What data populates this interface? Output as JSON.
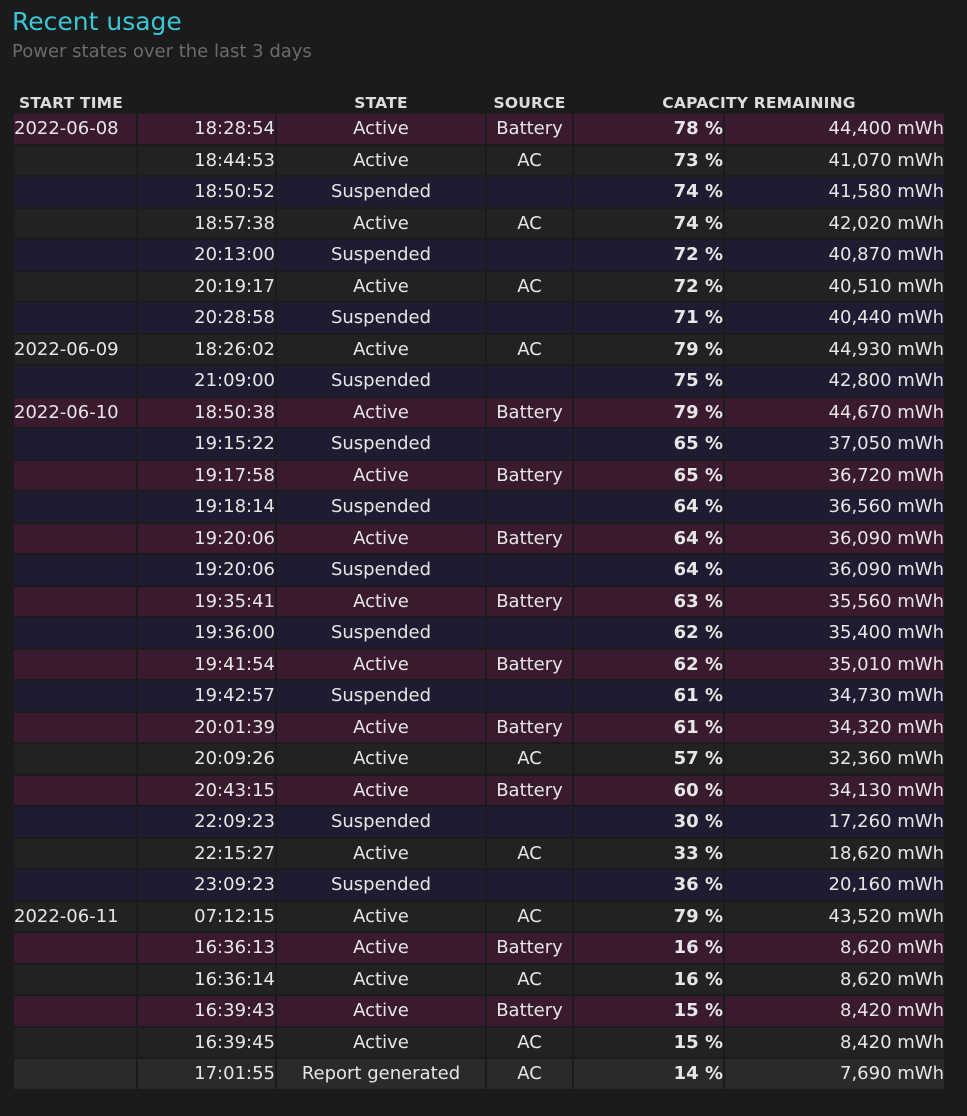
{
  "header": {
    "title": "Recent usage",
    "subtitle": "Power states over the last 3 days"
  },
  "columns": {
    "start_time": "START TIME",
    "state": "STATE",
    "source": "SOURCE",
    "capacity": "CAPACITY REMAINING"
  },
  "rows": [
    {
      "date": "2022-06-08",
      "time": "18:28:54",
      "state": "Active",
      "source": "Battery",
      "percent": "78 %",
      "capacity": "44,400 mWh"
    },
    {
      "date": "",
      "time": "18:44:53",
      "state": "Active",
      "source": "AC",
      "percent": "73 %",
      "capacity": "41,070 mWh"
    },
    {
      "date": "",
      "time": "18:50:52",
      "state": "Suspended",
      "source": "",
      "percent": "74 %",
      "capacity": "41,580 mWh"
    },
    {
      "date": "",
      "time": "18:57:38",
      "state": "Active",
      "source": "AC",
      "percent": "74 %",
      "capacity": "42,020 mWh"
    },
    {
      "date": "",
      "time": "20:13:00",
      "state": "Suspended",
      "source": "",
      "percent": "72 %",
      "capacity": "40,870 mWh"
    },
    {
      "date": "",
      "time": "20:19:17",
      "state": "Active",
      "source": "AC",
      "percent": "72 %",
      "capacity": "40,510 mWh"
    },
    {
      "date": "",
      "time": "20:28:58",
      "state": "Suspended",
      "source": "",
      "percent": "71 %",
      "capacity": "40,440 mWh"
    },
    {
      "date": "2022-06-09",
      "time": "18:26:02",
      "state": "Active",
      "source": "AC",
      "percent": "79 %",
      "capacity": "44,930 mWh"
    },
    {
      "date": "",
      "time": "21:09:00",
      "state": "Suspended",
      "source": "",
      "percent": "75 %",
      "capacity": "42,800 mWh"
    },
    {
      "date": "2022-06-10",
      "time": "18:50:38",
      "state": "Active",
      "source": "Battery",
      "percent": "79 %",
      "capacity": "44,670 mWh"
    },
    {
      "date": "",
      "time": "19:15:22",
      "state": "Suspended",
      "source": "",
      "percent": "65 %",
      "capacity": "37,050 mWh"
    },
    {
      "date": "",
      "time": "19:17:58",
      "state": "Active",
      "source": "Battery",
      "percent": "65 %",
      "capacity": "36,720 mWh"
    },
    {
      "date": "",
      "time": "19:18:14",
      "state": "Suspended",
      "source": "",
      "percent": "64 %",
      "capacity": "36,560 mWh"
    },
    {
      "date": "",
      "time": "19:20:06",
      "state": "Active",
      "source": "Battery",
      "percent": "64 %",
      "capacity": "36,090 mWh"
    },
    {
      "date": "",
      "time": "19:20:06",
      "state": "Suspended",
      "source": "",
      "percent": "64 %",
      "capacity": "36,090 mWh"
    },
    {
      "date": "",
      "time": "19:35:41",
      "state": "Active",
      "source": "Battery",
      "percent": "63 %",
      "capacity": "35,560 mWh"
    },
    {
      "date": "",
      "time": "19:36:00",
      "state": "Suspended",
      "source": "",
      "percent": "62 %",
      "capacity": "35,400 mWh"
    },
    {
      "date": "",
      "time": "19:41:54",
      "state": "Active",
      "source": "Battery",
      "percent": "62 %",
      "capacity": "35,010 mWh"
    },
    {
      "date": "",
      "time": "19:42:57",
      "state": "Suspended",
      "source": "",
      "percent": "61 %",
      "capacity": "34,730 mWh"
    },
    {
      "date": "",
      "time": "20:01:39",
      "state": "Active",
      "source": "Battery",
      "percent": "61 %",
      "capacity": "34,320 mWh"
    },
    {
      "date": "",
      "time": "20:09:26",
      "state": "Active",
      "source": "AC",
      "percent": "57 %",
      "capacity": "32,360 mWh"
    },
    {
      "date": "",
      "time": "20:43:15",
      "state": "Active",
      "source": "Battery",
      "percent": "60 %",
      "capacity": "34,130 mWh"
    },
    {
      "date": "",
      "time": "22:09:23",
      "state": "Suspended",
      "source": "",
      "percent": "30 %",
      "capacity": "17,260 mWh"
    },
    {
      "date": "",
      "time": "22:15:27",
      "state": "Active",
      "source": "AC",
      "percent": "33 %",
      "capacity": "18,620 mWh"
    },
    {
      "date": "",
      "time": "23:09:23",
      "state": "Suspended",
      "source": "",
      "percent": "36 %",
      "capacity": "20,160 mWh"
    },
    {
      "date": "2022-06-11",
      "time": "07:12:15",
      "state": "Active",
      "source": "AC",
      "percent": "79 %",
      "capacity": "43,520 mWh"
    },
    {
      "date": "",
      "time": "16:36:13",
      "state": "Active",
      "source": "Battery",
      "percent": "16 %",
      "capacity": "8,620 mWh"
    },
    {
      "date": "",
      "time": "16:36:14",
      "state": "Active",
      "source": "AC",
      "percent": "16 %",
      "capacity": "8,620 mWh"
    },
    {
      "date": "",
      "time": "16:39:43",
      "state": "Active",
      "source": "Battery",
      "percent": "15 %",
      "capacity": "8,420 mWh"
    },
    {
      "date": "",
      "time": "16:39:45",
      "state": "Active",
      "source": "AC",
      "percent": "15 %",
      "capacity": "8,420 mWh"
    },
    {
      "date": "",
      "time": "17:01:55",
      "state": "Report generated",
      "source": "AC",
      "percent": "14 %",
      "capacity": "7,690 mWh"
    }
  ],
  "colors": {
    "title": "#39c6d6",
    "battery_row": "#3a1a2f",
    "ac_row": "#222222",
    "suspended_row": "#1d1c30",
    "report_row": "#2a2a2a"
  }
}
